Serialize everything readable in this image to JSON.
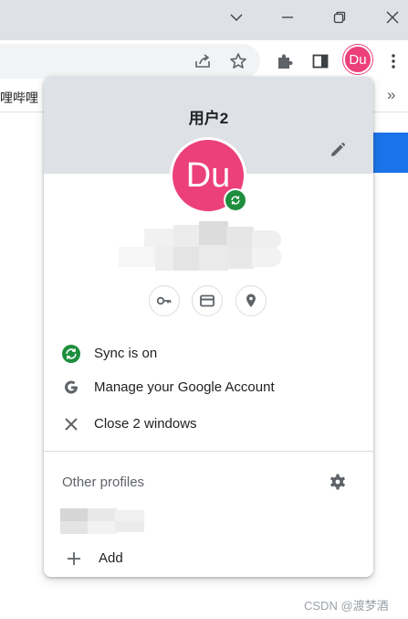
{
  "window_controls": {
    "tab_search": "chevron-down-icon",
    "minimize": "minimize-icon",
    "restore": "restore-icon",
    "close": "close-icon"
  },
  "toolbar": {
    "share": "share-icon",
    "bookmark": "star-icon",
    "extensions": "puzzle-icon",
    "side_panel": "side-panel-icon",
    "avatar_initials": "Du",
    "menu": "kebab-menu-icon"
  },
  "bookmarks_bar": {
    "item_text": "哩哔哩",
    "overflow": "»"
  },
  "profile_menu": {
    "title": "用户2",
    "avatar_initials": "Du",
    "avatar_color": "#ec407a",
    "sync_badge_color": "#1e8e3e",
    "quick_buttons": [
      "passwords-key-icon",
      "payment-card-icon",
      "addresses-pin-icon"
    ],
    "items": [
      {
        "icon": "sync-icon",
        "label": "Sync is on"
      },
      {
        "icon": "google-g-icon",
        "label": "Manage your Google Account"
      },
      {
        "icon": "close-icon",
        "label": "Close 2 windows"
      }
    ],
    "other_profiles_title": "Other profiles",
    "add_label": "Add"
  },
  "watermark": "CSDN @渡梦酒"
}
